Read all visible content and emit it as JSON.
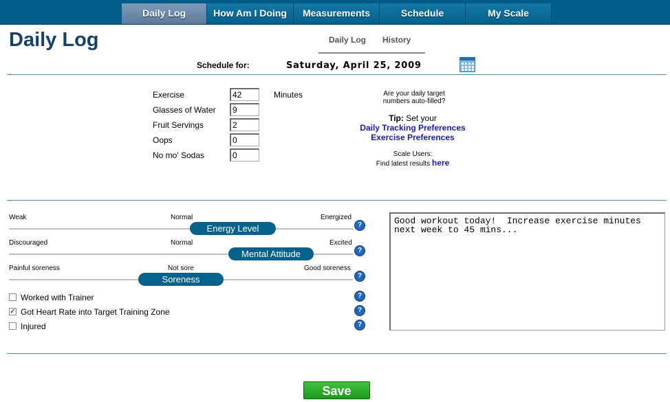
{
  "nav": {
    "tabs": [
      {
        "label": "Daily Log"
      },
      {
        "label": "How Am I Doing"
      },
      {
        "label": "Measurements"
      },
      {
        "label": "Schedule"
      },
      {
        "label": "My Scale"
      }
    ],
    "active": "Daily Log"
  },
  "page": {
    "title": "Daily Log",
    "subtabs": [
      "Daily Log",
      "History"
    ],
    "schedule_label": "Schedule for:",
    "schedule_date": "Saturday, April 25, 2009"
  },
  "tracking": {
    "fields": [
      {
        "label": "Exercise",
        "value": "42"
      },
      {
        "label": "Glasses of Water",
        "value": "9"
      },
      {
        "label": "Fruit Servings",
        "value": "2"
      },
      {
        "label": "Oops",
        "value": "0"
      },
      {
        "label": "No mo' Sodas",
        "value": "0"
      }
    ],
    "exercise_unit": "Minutes"
  },
  "tips": {
    "question": "Are your daily target numbers auto-filled?",
    "tip_bold": "Tip:",
    "tip_text": "Set your",
    "link1": "Daily Tracking Preferences",
    "link2": "Exercise Preferences",
    "scale_users": "Scale Users:",
    "find_results": "Find latest results",
    "here": "here"
  },
  "sliders": [
    {
      "name": "Energy Level",
      "low": "Weak",
      "mid": "Normal",
      "high": "Energized",
      "position": 0.65
    },
    {
      "name": "Mental Attitude",
      "low": "Discouraged",
      "mid": "Normal",
      "high": "Excited",
      "position": 0.77
    },
    {
      "name": "Soreness",
      "low": "Painful soreness",
      "mid": "Not sore",
      "high": "Good soreness",
      "position": 0.5
    }
  ],
  "checkboxes": [
    {
      "label": "Worked with Trainer",
      "checked": false
    },
    {
      "label": "Got Heart Rate into Target Training Zone",
      "checked": true
    },
    {
      "label": "Injured",
      "checked": false
    }
  ],
  "notes": "Good workout today!  Increase exercise minutes next week to 45 mins...",
  "save_label": "Save",
  "help_glyph": "?",
  "check_glyph": "✓",
  "colors": {
    "nav_bg": "#005d87",
    "title": "#16416b",
    "pill": "#06628a",
    "save": "#2aa82a",
    "link": "#1818b8"
  }
}
